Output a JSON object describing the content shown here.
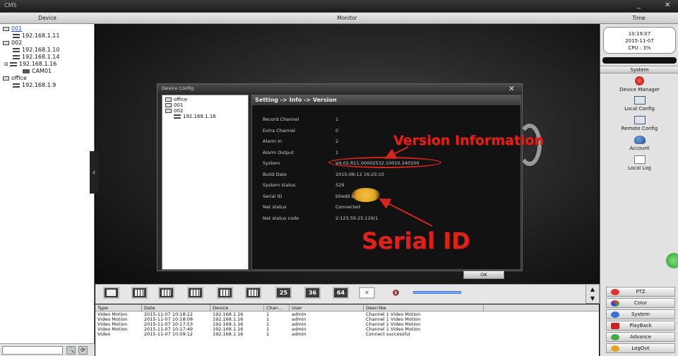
{
  "window": {
    "app_name": "CMS",
    "min_label": "_",
    "close_label": "✕"
  },
  "headers": {
    "device": "Device",
    "monitor": "Monitor",
    "time": "Time"
  },
  "device_tree": [
    {
      "label": "001",
      "kind": "group",
      "selected": true
    },
    {
      "label": "192.168.1.11",
      "kind": "device"
    },
    {
      "label": "002",
      "kind": "group"
    },
    {
      "label": "192.168.1.10",
      "kind": "device"
    },
    {
      "label": "192.168.1.14",
      "kind": "device"
    },
    {
      "label": "192.168.1.16",
      "kind": "device"
    },
    {
      "label": "CAM01",
      "kind": "camera"
    },
    {
      "label": "office",
      "kind": "group"
    },
    {
      "label": "192.168.1.9",
      "kind": "device"
    }
  ],
  "left_bottom": {
    "btn1": "🔍",
    "btn2": "⟳"
  },
  "dialog": {
    "title": "Device Config",
    "close": "✕",
    "tree": [
      {
        "label": "office"
      },
      {
        "label": "001"
      },
      {
        "label": "002"
      },
      {
        "label": "192.168.1.16"
      }
    ],
    "panel_title": "Setting -> Info -> Version",
    "rows": [
      {
        "label": "Record Channel",
        "value": "1"
      },
      {
        "label": "Extra Channel",
        "value": "0"
      },
      {
        "label": "Alarm In",
        "value": "2"
      },
      {
        "label": "Alarm Output",
        "value": "1"
      },
      {
        "label": "System",
        "value": "V4.02.R11.00002532.10010.240100"
      },
      {
        "label": "Build Date",
        "value": "2015-08-12 16:25:10"
      },
      {
        "label": "System status",
        "value": "529"
      },
      {
        "label": "Serial ID",
        "value": "b5edd          baa8"
      },
      {
        "label": "Nat status",
        "value": "Connected"
      },
      {
        "label": "Nat status code",
        "value": "2:123.59.25.129/1"
      }
    ],
    "ok": "OK"
  },
  "annotations": {
    "version": "Version Information",
    "serial": "Serial ID",
    "color": "#d8241d"
  },
  "clock": {
    "time": "10:19:07",
    "date": "2015-11-07",
    "cpu": "CPU : 3%"
  },
  "system": {
    "header": "System",
    "items": [
      {
        "label": "Device Manager",
        "icon": "device-manager-icon"
      },
      {
        "label": "Local Config",
        "icon": "local-config-icon"
      },
      {
        "label": "Remote Config",
        "icon": "remote-config-icon"
      },
      {
        "label": "Account",
        "icon": "account-icon"
      },
      {
        "label": "Local Log",
        "icon": "local-log-icon"
      }
    ]
  },
  "toolbar": {
    "split25": "25",
    "split36": "36",
    "split64": "64"
  },
  "events": {
    "columns": [
      "Type",
      "Date",
      "Device",
      "Chan...",
      "User",
      "Describe"
    ],
    "rows": [
      [
        "Video Motion",
        "2015-11-07 10:18:22",
        "192.168.1.16",
        "1",
        "admin",
        "Channel 1 Video Motion"
      ],
      [
        "Video Motion",
        "2015-11-07 10:18:08",
        "192.168.1.16",
        "1",
        "admin",
        "Channel 1 Video Motion"
      ],
      [
        "Video Motion",
        "2015-11-07 10:17:53",
        "192.168.1.16",
        "1",
        "admin",
        "Channel 1 Video Motion"
      ],
      [
        "Video Motion",
        "2015-11-07 10:17:49",
        "192.168.1.16",
        "1",
        "admin",
        "Channel 1 Video Motion"
      ],
      [
        "Video",
        "2015-11-07 10:09:12",
        "192.168.1.16",
        "1",
        "admin",
        "Connect successful"
      ]
    ]
  },
  "controls": {
    "ptz": "PTZ",
    "color": "Color",
    "system": "System",
    "playback": "PlayBack",
    "advance": "Advance",
    "logout": "LogOut"
  }
}
